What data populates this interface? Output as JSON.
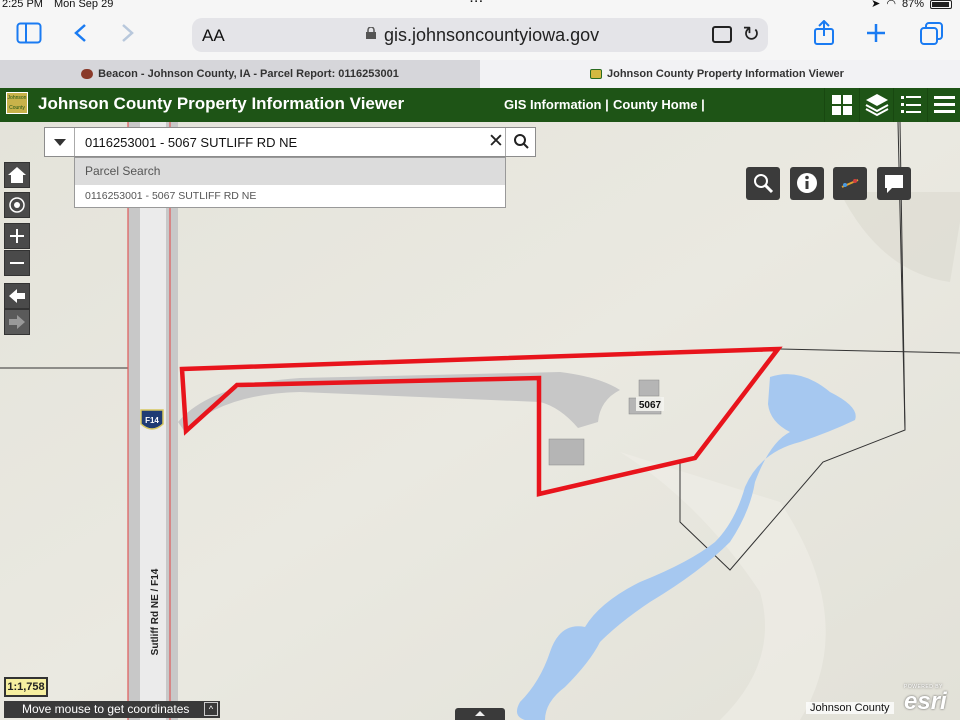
{
  "status_bar": {
    "time": "2:25 PM",
    "date": "Mon Sep 29",
    "battery": "87%"
  },
  "safari": {
    "text_size_label": "AA",
    "url": "gis.johnsoncountyiowa.gov"
  },
  "tabs": [
    {
      "label": "Beacon - Johnson County, IA - Parcel Report: 0116253001",
      "active": false
    },
    {
      "label": "Johnson County Property Information Viewer",
      "active": true
    }
  ],
  "app": {
    "logo_text": "Johnson County",
    "title": "Johnson County Property Information Viewer",
    "links": [
      "GIS Information |",
      "County Home |"
    ]
  },
  "search": {
    "value": "0116253001 - 5067 SUTLIFF RD NE",
    "suggestion_header": "Parcel Search",
    "suggestion_item": "0116253001 - 5067 SUTLIFF RD NE"
  },
  "map": {
    "road_label": "Sutliff Rd NE / F14",
    "shield_label": "F14",
    "address_label": "5067",
    "parcel_color": "#e8141c",
    "water_color": "#a6c8f0"
  },
  "footer": {
    "scale": "1:1,758",
    "coords": "Move mouse to get coordinates",
    "attribution": "Johnson County",
    "esri_powered": "POWERED BY",
    "esri_brand": "esri"
  }
}
